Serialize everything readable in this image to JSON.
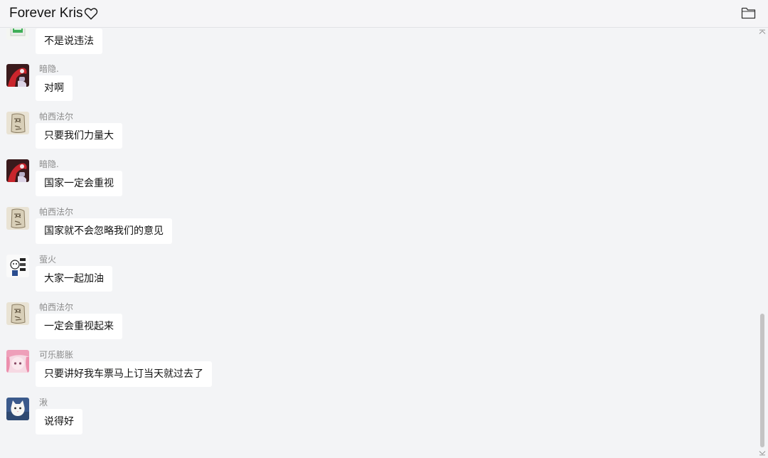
{
  "header": {
    "title": "Forever Kris"
  },
  "messages": [
    {
      "sender": "",
      "text": "不是说违法",
      "avatar": "green-sign-avatar"
    },
    {
      "sender": "暗隐.",
      "text": "对啊",
      "avatar": "red-character-avatar"
    },
    {
      "sender": "帕西法尔",
      "text": "只要我们力量大",
      "avatar": "doodle-avatar"
    },
    {
      "sender": "暗隐.",
      "text": "国家一定会重视",
      "avatar": "red-character-avatar"
    },
    {
      "sender": "帕西法尔",
      "text": "国家就不会忽略我们的意见",
      "avatar": "doodle-avatar"
    },
    {
      "sender": "萤火",
      "text": "大家一起加油",
      "avatar": "meme-avatar"
    },
    {
      "sender": "帕西法尔",
      "text": "一定会重视起来",
      "avatar": "doodle-avatar"
    },
    {
      "sender": "可乐膨胀",
      "text": "只要讲好我车票马上订当天就过去了",
      "avatar": "pink-anime-avatar"
    },
    {
      "sender": "湫",
      "text": "说得好",
      "avatar": "cat-avatar"
    }
  ],
  "colors": {
    "background": "#f3f4f6",
    "bubble": "#ffffff",
    "sender_text": "#8a8a8a",
    "scroll_thumb": "#c4c4c4"
  },
  "icons": {
    "favorite": "heart-icon",
    "files": "folder-icon",
    "scroll_up": "chevron-up-icon",
    "scroll_down": "chevron-down-icon"
  }
}
